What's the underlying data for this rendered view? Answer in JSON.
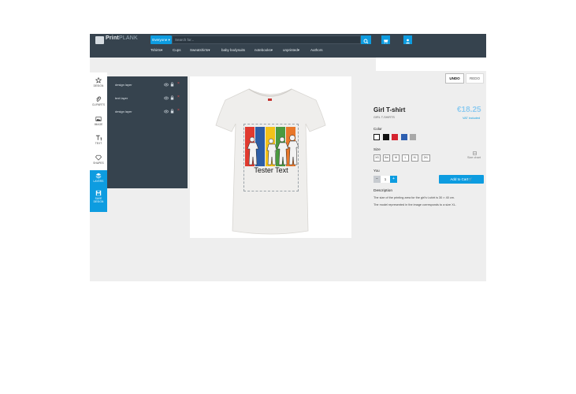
{
  "header": {
    "logo_brand": "Print",
    "logo_suffix": "PLANK",
    "category_label": "Everyone ▾",
    "search_placeholder": "Search for..."
  },
  "nav": {
    "items": [
      "Tshirts▾",
      "Cups",
      "Sweatshirts▾",
      "baby bodysuits",
      "notebooks▾",
      "unprinted▾",
      "Authors"
    ]
  },
  "tools": [
    {
      "label": "DESIGN",
      "icon": "star-icon"
    },
    {
      "label": "CLIPARTS",
      "icon": "paperclip-icon"
    },
    {
      "label": "IMAGE",
      "icon": "image-icon"
    },
    {
      "label": "TEXT",
      "icon": "text-icon"
    },
    {
      "label": "SHAPES",
      "icon": "diamond-icon"
    },
    {
      "label": "LAYERS",
      "icon": "layers-icon"
    },
    {
      "label": "SAVE DESIGN",
      "icon": "save-icon"
    }
  ],
  "layers": [
    {
      "name": "design layer"
    },
    {
      "name": "text layer"
    },
    {
      "name": "design layer"
    }
  ],
  "canvas": {
    "text_layer": "Tester Text"
  },
  "history": {
    "undo": "UNDO",
    "redo": "REDO"
  },
  "product": {
    "title": "Girl T-shirt",
    "subtitle": "GIRL T-SHIRTS",
    "price": "€18.25",
    "vat": "VAT included",
    "color_label": "Color",
    "colors": [
      "#ffffff",
      "#111111",
      "#d5232f",
      "#2e5fb0",
      "#a8a8a8"
    ],
    "size_label": "Size",
    "sizes": [
      "XS",
      "Sm",
      "M",
      "L",
      "XL",
      "2XL"
    ],
    "size_chart": "Size chart",
    "qty_label": "You",
    "qty_minus": "−",
    "qty_value": "1",
    "qty_plus": "+",
    "add_to_cart": "Add to Cart🛒",
    "description_title": "Description",
    "description_lines": [
      "The size of the printing area for the girl's t-shirt is 30 × 40 cm.",
      "The model represented in the image corresponds to a size XL."
    ]
  }
}
